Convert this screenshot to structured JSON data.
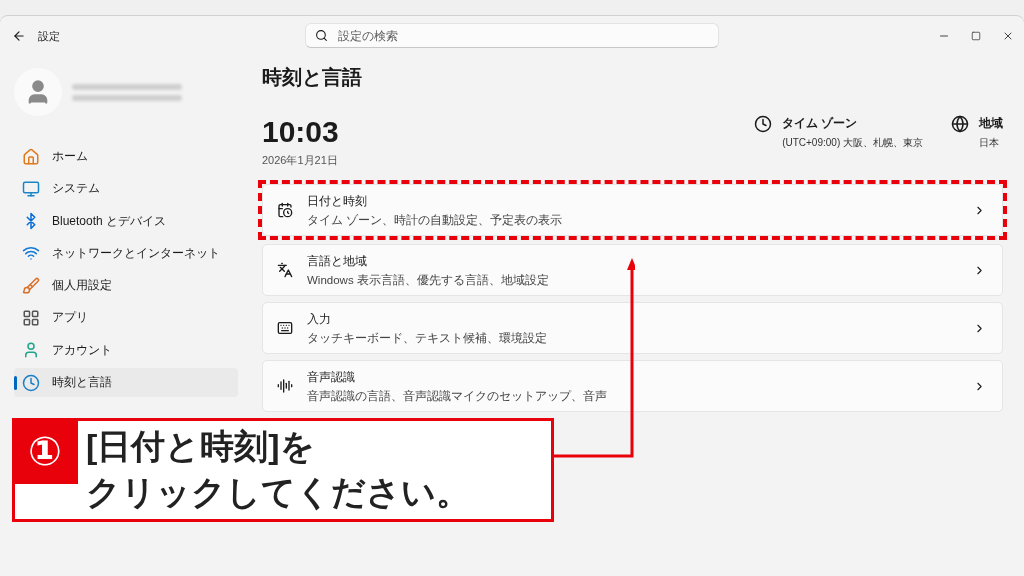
{
  "window": {
    "title": "設定",
    "search_placeholder": "設定の検索"
  },
  "sidebar": {
    "items": [
      {
        "label": "ホーム",
        "selected": false
      },
      {
        "label": "システム",
        "selected": false
      },
      {
        "label": "Bluetooth とデバイス",
        "selected": false
      },
      {
        "label": "ネットワークとインターネット",
        "selected": false
      },
      {
        "label": "個人用設定",
        "selected": false
      },
      {
        "label": "アプリ",
        "selected": false
      },
      {
        "label": "アカウント",
        "selected": false
      },
      {
        "label": "時刻と言語",
        "selected": true
      }
    ]
  },
  "page": {
    "title": "時刻と言語",
    "time": "10:03",
    "date": "2026年1月21日",
    "info": [
      {
        "label": "タイム ゾーン",
        "value": "(UTC+09:00) 大阪、札幌、東京"
      },
      {
        "label": "地域",
        "value": "日本"
      }
    ]
  },
  "cards": [
    {
      "title": "日付と時刻",
      "subtitle": "タイム ゾーン、時計の自動設定、予定表の表示",
      "highlighted": true
    },
    {
      "title": "言語と地域",
      "subtitle": "Windows 表示言語、優先する言語、地域設定",
      "highlighted": false
    },
    {
      "title": "入力",
      "subtitle": "タッチキーボード、テキスト候補、環境設定",
      "highlighted": false
    },
    {
      "title": "音声認識",
      "subtitle": "音声認識の言語、音声認識マイクのセットアップ、音声",
      "highlighted": false
    }
  ],
  "callout": {
    "number": "①",
    "lines": [
      "[日付と時刻]を",
      "クリックしてください。"
    ]
  }
}
